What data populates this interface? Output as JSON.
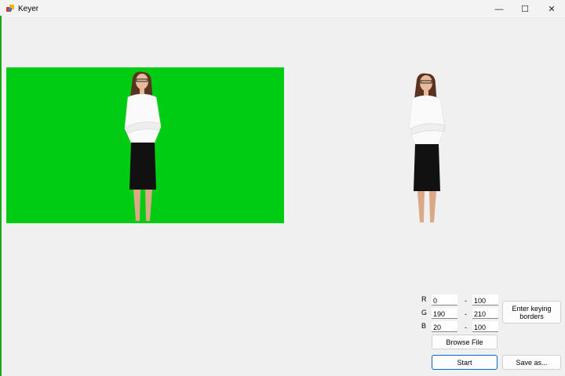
{
  "window": {
    "title": "Keyer",
    "minimize": "—",
    "maximize": "☐",
    "close": "✕"
  },
  "controls": {
    "r_label": "R",
    "g_label": "G",
    "b_label": "B",
    "r_min": "0",
    "r_max": "100",
    "g_min": "190",
    "g_max": "210",
    "b_min": "20",
    "b_max": "100",
    "dash": "-",
    "enter_button": "Enter keying borders",
    "browse_button": "Browse File",
    "start_button": "Start",
    "save_button": "Save as..."
  },
  "colors": {
    "key_green": "#00cc14"
  }
}
